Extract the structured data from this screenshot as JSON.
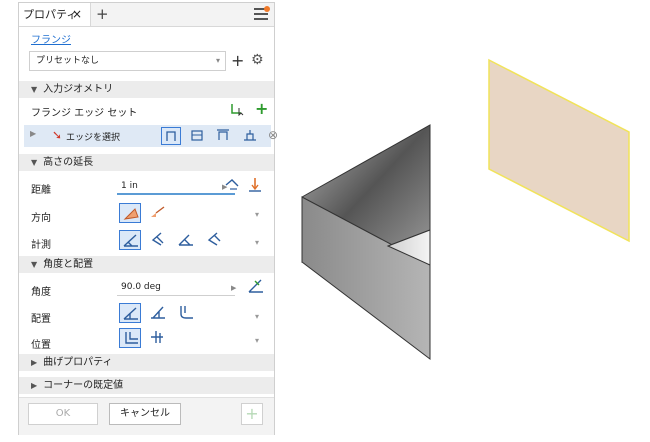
{
  "panel": {
    "tab_title": "プロパティ",
    "tab_close": "×",
    "tab_add": "+",
    "feature_link": "フランジ",
    "preset": {
      "value": "プリセットなし"
    },
    "sections": {
      "input_geometry": "入力ジオメトリ",
      "height_extent": "高さの延長",
      "angle_placement": "角度と配置",
      "bend_properties": "曲げプロパティ",
      "corner_defaults": "コーナーの既定値"
    },
    "edge_set_label": "フランジ エッジ セット",
    "select_edges": "エッジを選択",
    "distance_label": "距離",
    "distance_value": "1 in",
    "direction_label": "方向",
    "measure_label": "計測",
    "angle_label": "角度",
    "angle_value": "90.0 deg",
    "placement_label": "配置",
    "position_label": "位置",
    "ok_label": "OK",
    "cancel_label": "キャンセル"
  },
  "colors": {
    "accent": "#3a7bd5",
    "highlight_face": "#e8d6c4",
    "highlight_edge": "#f1e35a",
    "add_green": "#2e9b2e",
    "notification": "#f07a2a"
  }
}
